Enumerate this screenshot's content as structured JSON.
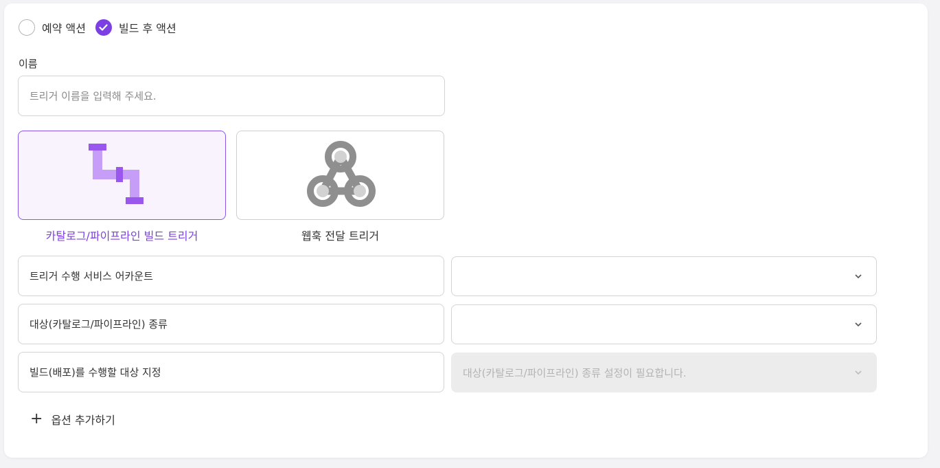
{
  "trigger_type_radio": {
    "options": [
      {
        "label": "예약 액션",
        "checked": false
      },
      {
        "label": "빌드 후 액션",
        "checked": true
      }
    ]
  },
  "name_field": {
    "label": "이름",
    "value": "",
    "placeholder": "트리거 이름을 입력해 주세요."
  },
  "source_types": [
    {
      "label": "카탈로그/파이프라인 빌드 트리거",
      "icon": "pipe-icon",
      "selected": true
    },
    {
      "label": "웹훅 전달 트리거",
      "icon": "webhook-icon",
      "selected": false
    }
  ],
  "options": [
    {
      "label": "트리거 수행 서비스 어카운트",
      "select_value": "",
      "disabled": false
    },
    {
      "label": "대상(카탈로그/파이프라인) 종류",
      "select_value": "",
      "disabled": false
    },
    {
      "label": "빌드(배포)를 수행할 대상 지정",
      "select_value": "대상(카탈로그/파이프라인) 종류 설정이 필요합니다.",
      "disabled": true
    }
  ],
  "add_option": {
    "label": "옵션 추가하기",
    "icon": "plus-icon"
  },
  "colors": {
    "accent": "#7b3fe4",
    "pipe_light": "#c79ef7",
    "pipe_dark": "#9a57ee",
    "webhook_gray": "#8f8f8f",
    "disabled_bg": "#ececec"
  }
}
